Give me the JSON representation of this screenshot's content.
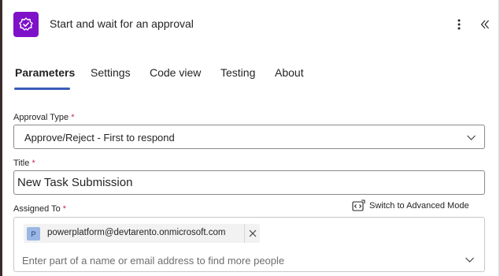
{
  "header": {
    "title": "Start and wait for an approval",
    "icon": "approval-check-icon",
    "icon_bg": "#7d12c9",
    "more_icon": "more-vertical-icon",
    "collapse_icon": "double-chevron-left-icon"
  },
  "tabs": [
    {
      "label": "Parameters",
      "active": true
    },
    {
      "label": "Settings",
      "active": false
    },
    {
      "label": "Code view",
      "active": false
    },
    {
      "label": "Testing",
      "active": false
    },
    {
      "label": "About",
      "active": false
    }
  ],
  "accent_color": "#3b5cb8",
  "required_color": "#c4314b",
  "fields": {
    "approval_type": {
      "label": "Approval Type",
      "required_mark": "*",
      "value": "Approve/Reject - First to respond"
    },
    "title": {
      "label": "Title",
      "required_mark": "*",
      "value": "New Task Submission"
    },
    "assigned_to": {
      "label": "Assigned To",
      "required_mark": "*",
      "advanced_mode_label": "Switch to Advanced Mode",
      "chip": {
        "initial": "P",
        "email": "powerplatform@devtarento.onmicrosoft.com"
      },
      "placeholder": "Enter part of a name or email address to find more people"
    }
  }
}
